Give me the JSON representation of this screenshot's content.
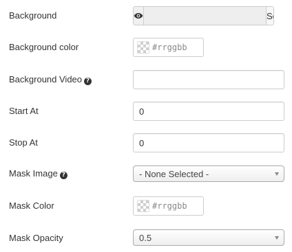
{
  "fields": {
    "background": {
      "label": "Background",
      "select_label": "Select"
    },
    "background_color": {
      "label": "Background color",
      "placeholder": "#rrggbb"
    },
    "background_video": {
      "label": "Background Video",
      "value": ""
    },
    "start_at": {
      "label": "Start At",
      "value": "0"
    },
    "stop_at": {
      "label": "Stop At",
      "value": "0"
    },
    "mask_image": {
      "label": "Mask Image",
      "selected": "- None Selected -"
    },
    "mask_color": {
      "label": "Mask Color",
      "placeholder": "#rrggbb"
    },
    "mask_opacity": {
      "label": "Mask Opacity",
      "selected": "0.5"
    }
  },
  "icons": {
    "preview": "eye-icon",
    "clear": "close-icon",
    "help": "question-circle-icon",
    "dropdown": "caret-down-icon"
  }
}
